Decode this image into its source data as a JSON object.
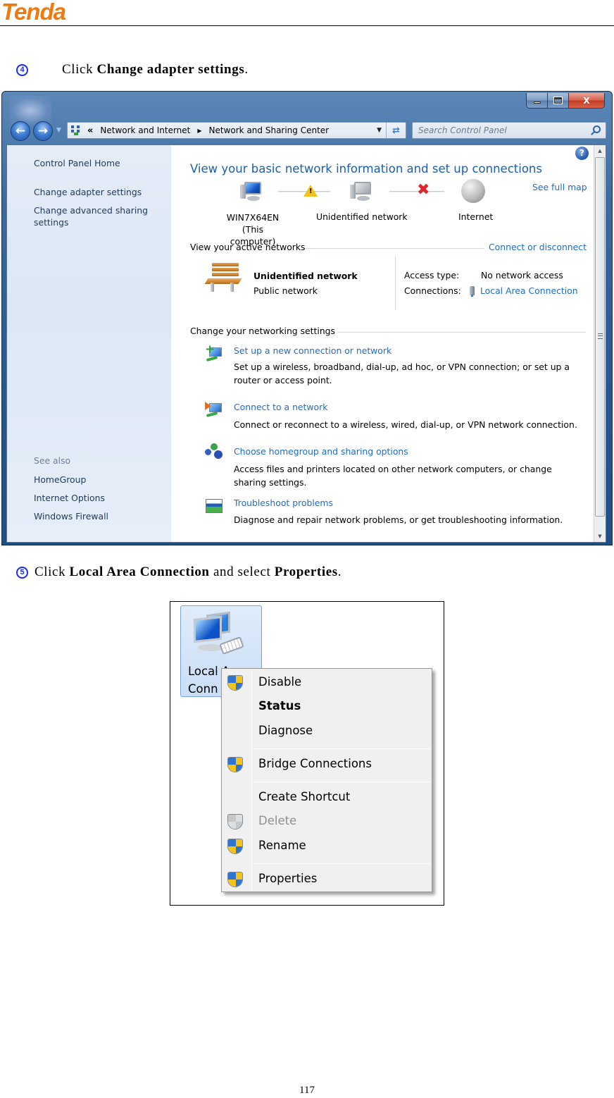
{
  "document": {
    "logo": "Tenda",
    "page_number": "117",
    "steps": [
      {
        "number": "4",
        "prefix": "Click ",
        "bold": "Change adapter settings",
        "suffix": "."
      },
      {
        "number": "5",
        "prefix": "Click ",
        "bold": "Local Area Connection",
        "middle": " and select ",
        "bold2": "Properties",
        "suffix": "."
      }
    ]
  },
  "window": {
    "controls": {
      "minimize": "minimize",
      "maximize": "maximize",
      "close": "X"
    },
    "address_bar": {
      "chevron": "«",
      "breadcrumbs": [
        "Network and Internet",
        "Network and Sharing Center"
      ]
    },
    "search": {
      "placeholder": "Search Control Panel"
    },
    "sidebar": {
      "links": [
        "Control Panel Home",
        "Change adapter settings",
        "Change advanced sharing settings"
      ],
      "see_also_heading": "See also",
      "see_also": [
        "HomeGroup",
        "Internet Options",
        "Windows Firewall"
      ]
    },
    "main": {
      "title": "View your basic network information and set up connections",
      "see_full_map": "See full map",
      "map": {
        "computer_name": "WIN7X64EN",
        "computer_sub": "(This computer)",
        "network": "Unidentified network",
        "internet": "Internet"
      },
      "active_networks": {
        "heading": "View your active networks",
        "connect_link": "Connect or disconnect",
        "network_name": "Unidentified network",
        "network_type": "Public network",
        "access_type_label": "Access type:",
        "access_type_value": "No network access",
        "connections_label": "Connections:",
        "connections_value": "Local Area Connection"
      },
      "settings": {
        "heading": "Change your networking settings",
        "tasks": [
          {
            "title": "Set up a new connection or network",
            "desc": "Set up a wireless, broadband, dial-up, ad hoc, or VPN connection; or set up a router or access point."
          },
          {
            "title": "Connect to a network",
            "desc": "Connect or reconnect to a wireless, wired, dial-up, or VPN network connection."
          },
          {
            "title": "Choose homegroup and sharing options",
            "desc": "Access files and printers located on other network computers, or change sharing settings."
          },
          {
            "title": "Troubleshoot problems",
            "desc": "Diagnose and repair network problems, or get troubleshooting information."
          }
        ]
      }
    }
  },
  "adapter_menu": {
    "tile_label_line1": "Local A",
    "tile_label_line2": "Conn",
    "items": [
      {
        "label": "Disable",
        "icon": "shield-icon",
        "style": "normal"
      },
      {
        "label": "Status",
        "icon": "",
        "style": "bold"
      },
      {
        "label": "Diagnose",
        "icon": "",
        "style": "normal"
      },
      {
        "label": "Bridge Connections",
        "icon": "shield-icon",
        "style": "normal"
      },
      {
        "label": "Create Shortcut",
        "icon": "",
        "style": "normal"
      },
      {
        "label": "Delete",
        "icon": "shield-icon-disabled",
        "style": "disabled"
      },
      {
        "label": "Rename",
        "icon": "shield-icon",
        "style": "normal"
      },
      {
        "label": "Properties",
        "icon": "shield-icon",
        "style": "normal"
      }
    ]
  }
}
